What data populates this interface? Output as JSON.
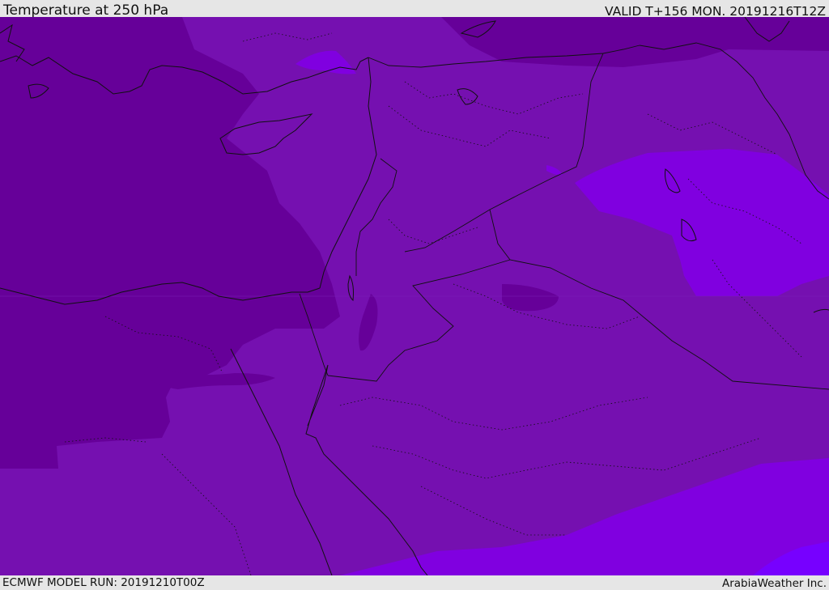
{
  "header": {
    "title": "Temperature at 250 hPa",
    "valid": "VALID T+156 MON. 20191216T12Z"
  },
  "footer": {
    "model_run": "ECMWF MODEL RUN: 20191210T00Z",
    "credit": "ArabiaWeather Inc."
  },
  "map": {
    "field": "temperature",
    "pressure_level_hpa": 250,
    "colors": {
      "dark_purple": "#660099",
      "mid_purple": "#7510b0",
      "light_violet": "#8000e0",
      "bright_violet": "#7700ff",
      "boundary_line": "#111111"
    }
  }
}
